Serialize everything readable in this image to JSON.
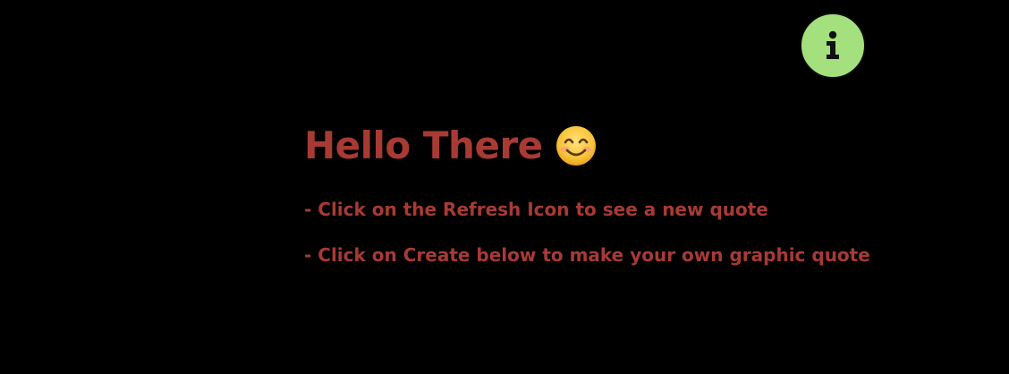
{
  "info_button": {
    "icon": "info-icon",
    "color": "#a4e07e"
  },
  "welcome": {
    "greeting": "Hello There",
    "emoji": "smiling-face-emoji",
    "lines": [
      "- Click on the Refresh Icon to see a new quote",
      "- Click on Create below to make your own graphic quote"
    ],
    "text_color": "#a83a34"
  }
}
